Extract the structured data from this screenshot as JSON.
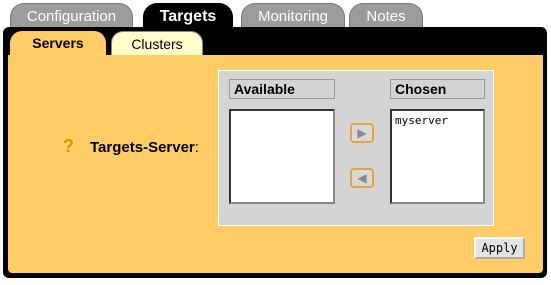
{
  "tabs": {
    "configuration": "Configuration",
    "targets": "Targets",
    "monitoring": "Monitoring",
    "notes": "Notes"
  },
  "subtabs": {
    "servers": "Servers",
    "clusters": "Clusters"
  },
  "field": {
    "help": "?",
    "label": "Targets-Server",
    "colon": ":"
  },
  "selector": {
    "available_header": "Available",
    "chosen_header": "Chosen",
    "chosen_items": [
      "myserver"
    ]
  },
  "apply_label": "Apply",
  "colors": {
    "panel": "#ffcc66",
    "frame": "#000000",
    "inactive_tab": "#9c9c9c"
  }
}
